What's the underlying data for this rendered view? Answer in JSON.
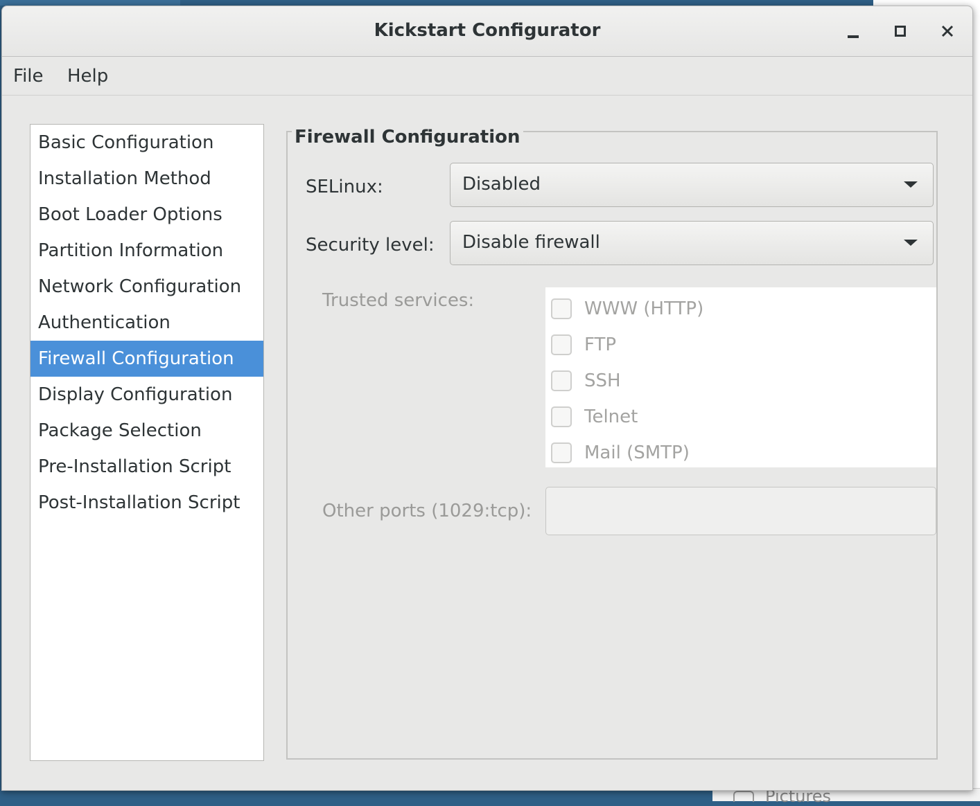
{
  "window": {
    "title": "Kickstart Configurator"
  },
  "menubar": {
    "items": [
      "File",
      "Help"
    ]
  },
  "sidebar": {
    "items": [
      {
        "label": "Basic Configuration"
      },
      {
        "label": "Installation Method"
      },
      {
        "label": "Boot Loader Options"
      },
      {
        "label": "Partition Information"
      },
      {
        "label": "Network Configuration"
      },
      {
        "label": "Authentication"
      },
      {
        "label": "Firewall Configuration",
        "selected": true
      },
      {
        "label": "Display Configuration"
      },
      {
        "label": "Package Selection"
      },
      {
        "label": "Pre-Installation Script"
      },
      {
        "label": "Post-Installation Script"
      }
    ]
  },
  "panel": {
    "title": "Firewall Configuration",
    "selinux": {
      "label": "SELinux:",
      "value": "Disabled"
    },
    "security_level": {
      "label": "Security level:",
      "value": "Disable firewall"
    },
    "trusted_services": {
      "label": "Trusted services:",
      "items": [
        {
          "label": "WWW (HTTP)",
          "checked": false
        },
        {
          "label": "FTP",
          "checked": false
        },
        {
          "label": "SSH",
          "checked": false
        },
        {
          "label": "Telnet",
          "checked": false
        },
        {
          "label": "Mail (SMTP)",
          "checked": false
        }
      ]
    },
    "other_ports": {
      "label": "Other ports (1029:tcp):",
      "value": ""
    }
  },
  "background": {
    "bottom_label": "Pictures"
  },
  "colors": {
    "selection": "#4a90d9",
    "window_bg": "#e8e8e7",
    "text": "#2e3436",
    "disabled_text": "#9a9a98"
  }
}
